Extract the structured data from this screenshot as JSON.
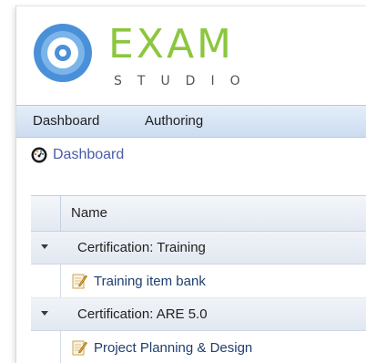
{
  "logo": {
    "title": "EXAM",
    "subtitle": "STUDIO"
  },
  "menu": {
    "items": [
      "Dashboard",
      "Authoring"
    ]
  },
  "breadcrumb": {
    "label": "Dashboard",
    "icon": "dashboard-gauge-icon"
  },
  "grid": {
    "header": {
      "name": "Name"
    },
    "groups": [
      {
        "label": "Certification: Training",
        "items": [
          {
            "label": "Training item bank",
            "icon": "edit-document-icon"
          }
        ]
      },
      {
        "label": "Certification: ARE 5.0",
        "items": [
          {
            "label": "Project Planning & Design",
            "icon": "edit-document-icon"
          }
        ]
      }
    ]
  },
  "colors": {
    "logo_green": "#8cc63f",
    "logo_blue": "#4a90d9",
    "menubar": "#ccdcf0",
    "link": "#4a5aa8"
  }
}
